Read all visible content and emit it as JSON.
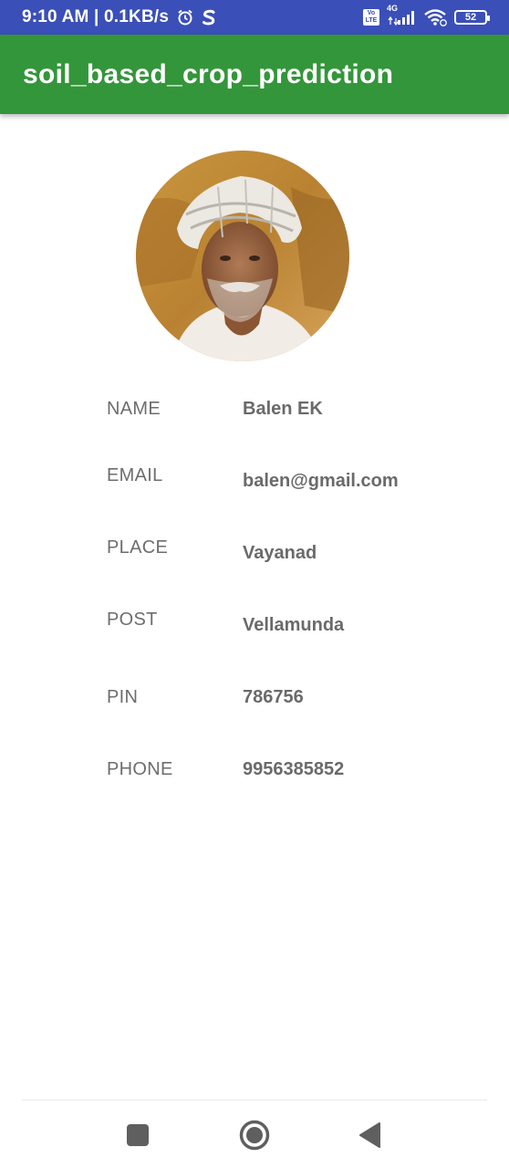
{
  "status_bar": {
    "time": "9:10 AM | 0.1KB/s",
    "network_label": "4G",
    "volte_label": "Vo LTE",
    "battery_level": "52"
  },
  "app_bar": {
    "title": "soil_based_crop_prediction"
  },
  "profile": {
    "fields": [
      {
        "label": "NAME",
        "value": "Balen EK"
      },
      {
        "label": "EMAIL",
        "value": "balen@gmail.com"
      },
      {
        "label": "PLACE",
        "value": "Vayanad"
      },
      {
        "label": "POST",
        "value": "Vellamunda"
      },
      {
        "label": "PIN",
        "value": "786756"
      },
      {
        "label": "PHONE",
        "value": "9956385852"
      }
    ]
  },
  "nav_bar": {
    "buttons": [
      "recents-icon",
      "home-icon",
      "back-icon"
    ]
  },
  "colors": {
    "status_bar": "#3b4fb8",
    "app_bar": "#33963a",
    "label_text": "#6d6d6d",
    "value_text": "#6a6a6a"
  }
}
